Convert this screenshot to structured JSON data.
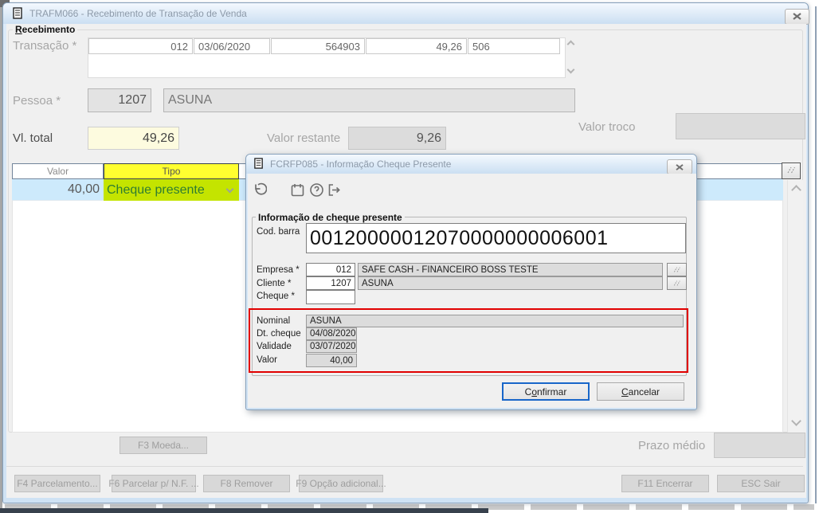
{
  "colors": {
    "accent-blue": "#1866c9",
    "title-text": "#8d9aa9",
    "label-gray": "#a6a6a6",
    "highlight-yellow": "#ffff30",
    "highlight-green": "#c4e400",
    "highlight-text-green": "#2f7d32",
    "row-blue": "#cdeafc",
    "annotation-red": "#e10000",
    "total-field-yellow": "#fdfbdf"
  },
  "main_window": {
    "title": "TRAFM066 - Recebimento de Transação de Venda",
    "group": {
      "hot": "R",
      "rest": "ecebimento"
    },
    "transacao": {
      "label": "Transação *",
      "empresa": "012",
      "data": "03/06/2020",
      "numero": "564903",
      "valor": "49,26",
      "serie": "506"
    },
    "pessoa": {
      "label": "Pessoa *",
      "code": "1207",
      "name": "ASUNA"
    },
    "vl_total": {
      "label": "Vl. total",
      "value": "49,26"
    },
    "valor_restante": {
      "label": "Valor restante",
      "value": "9,26"
    },
    "valor_troco": {
      "label": "Valor troco",
      "value": ""
    },
    "grid": {
      "col_valor": "Valor",
      "col_tipo": "Tipo",
      "row": {
        "valor": "40,00",
        "tipo": "Cheque presente"
      }
    },
    "f3_button": "F3 Moeda...",
    "prazo_medio": {
      "label": "Prazo médio",
      "value": ""
    },
    "buttons": {
      "f4": "F4 Parcelamento...",
      "f6": "F6 Parcelar p/ N.F. ...",
      "f8": "F8 Remover",
      "f9": "F9 Opção adicional...",
      "f11": "F11 Encerrar",
      "esc": "ESC Sair"
    }
  },
  "dialog": {
    "title": "FCRFP085 - Informação Cheque Presente",
    "toolbar": [
      "undo-icon",
      "calendar-icon",
      "help-icon",
      "exit-icon"
    ],
    "group_title": "Informação de cheque presente",
    "cod_barra": {
      "label": "Cod. barra",
      "value": "00120000012070000000006001"
    },
    "empresa": {
      "label": "Empresa *",
      "code": "012",
      "name": "SAFE CASH - FINANCEIRO BOSS TESTE"
    },
    "cliente": {
      "label": "Cliente *",
      "code": "1207",
      "name": "ASUNA"
    },
    "cheque": {
      "label": "Cheque *",
      "value": ""
    },
    "nominal": {
      "label": "Nominal",
      "value": "ASUNA"
    },
    "dt_cheque": {
      "label": "Dt. cheque",
      "value": "04/08/2020"
    },
    "validade": {
      "label": "Validade",
      "value": "03/07/2020"
    },
    "valor": {
      "label": "Valor",
      "value": "40,00"
    },
    "confirm": {
      "pre": "C",
      "hot": "o",
      "post": "nfirmar"
    },
    "cancel": {
      "pre": "",
      "hot": "C",
      "post": "ancelar"
    }
  }
}
